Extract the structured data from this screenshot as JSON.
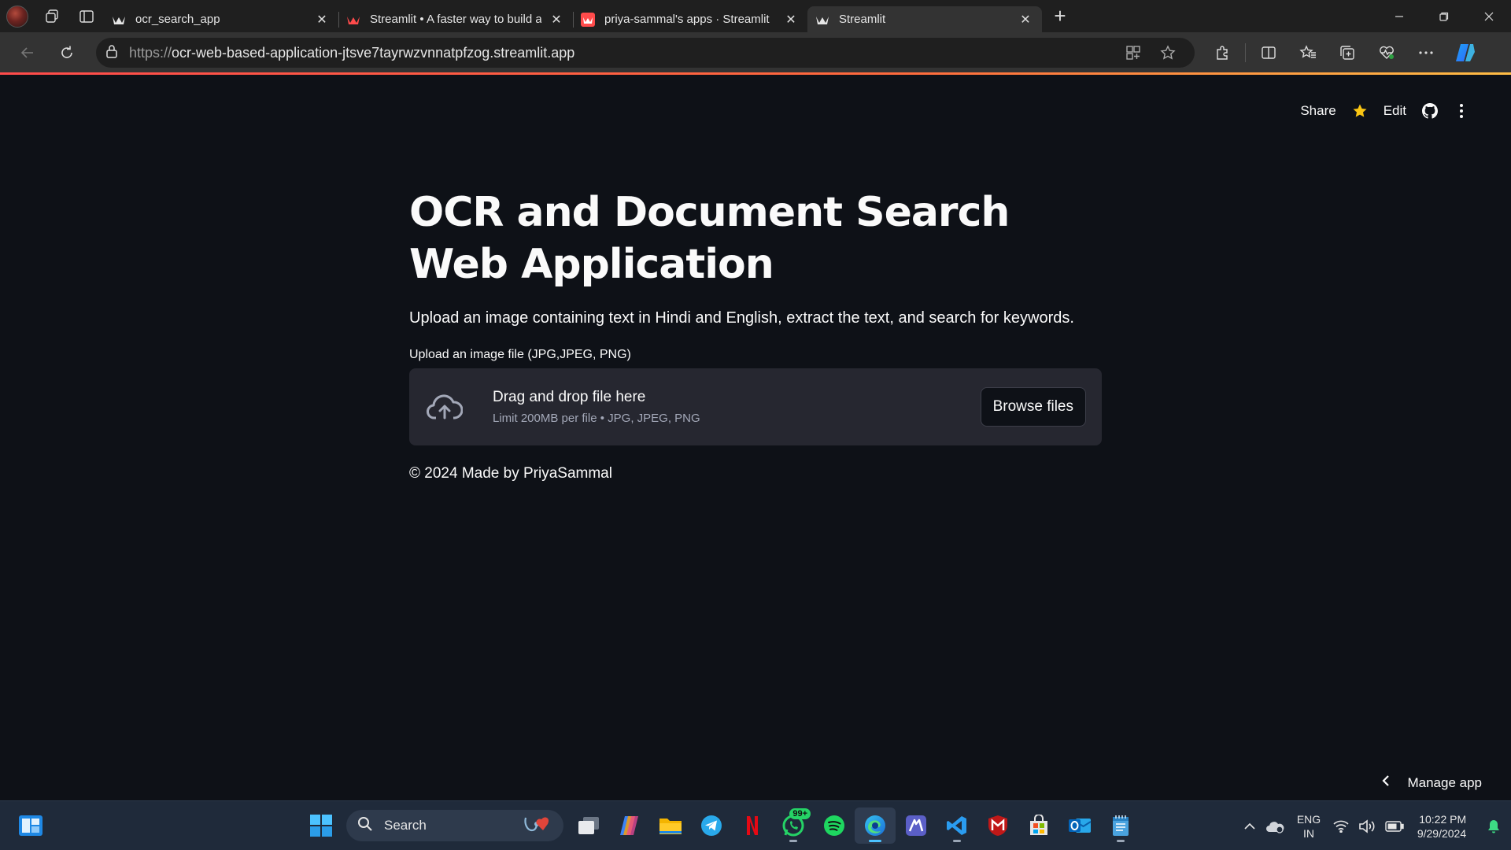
{
  "browser": {
    "tabs": [
      {
        "title": "ocr_search_app",
        "favicon": "streamlit-crown-icon",
        "active": false
      },
      {
        "title": "Streamlit • A faster way to build a",
        "favicon": "streamlit-crown-icon",
        "active": false
      },
      {
        "title": "priya-sammal's apps · Streamlit",
        "favicon": "streamlit-crown-icon",
        "active": false
      },
      {
        "title": "Streamlit",
        "favicon": "streamlit-crown-icon",
        "active": true
      }
    ],
    "url_protocol": "https://",
    "url_host": "ocr-web-based-application-jtsve7tayrwzvnnatpfzog.streamlit.app",
    "new_tab_glyph": "+",
    "close_glyph": "✕"
  },
  "streamlit_header": {
    "share_label": "Share",
    "edit_label": "Edit"
  },
  "app": {
    "title": "OCR and Document Search Web Application",
    "subtitle": "Upload an image containing text in Hindi and English, extract the text, and search for keywords.",
    "uploader": {
      "label": "Upload an image file (JPG,JPEG, PNG)",
      "drag_text": "Drag and drop file here",
      "limit_text": "Limit 200MB per file • JPG, JPEG, PNG",
      "browse_label": "Browse files"
    },
    "footer": "© 2024 Made by PriyaSammal"
  },
  "manage_app_label": "Manage app",
  "taskbar": {
    "search_label": "Search",
    "whatsapp_badge": "99+",
    "language": {
      "line1": "ENG",
      "line2": "IN"
    },
    "clock": {
      "time": "10:22 PM",
      "date": "9/29/2024"
    }
  },
  "colors": {
    "page_background": "#0e1117",
    "uploader_background": "#262730",
    "streamlit_red": "#ff4b4b",
    "star_yellow": "#f9c513"
  }
}
